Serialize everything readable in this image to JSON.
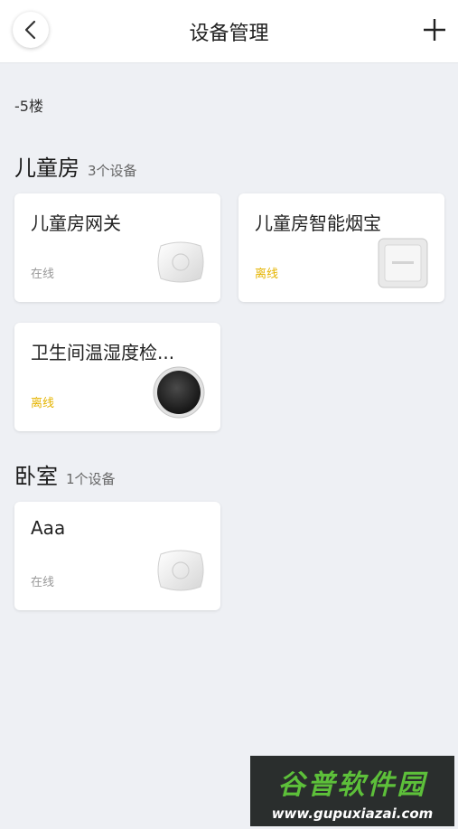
{
  "header": {
    "title": "设备管理",
    "back_icon": "chevron-left-icon",
    "add_icon": "plus-icon"
  },
  "floor_label": "-5楼",
  "rooms": [
    {
      "name": "儿童房",
      "count": "3个设备",
      "devices": [
        {
          "name": "儿童房网关",
          "status": "在线",
          "online": true,
          "icon": "gateway-device-icon"
        },
        {
          "name": "儿童房智能烟宝",
          "status": "离线",
          "online": false,
          "icon": "smoke-detector-icon"
        },
        {
          "name": "卫生间温湿度检...",
          "status": "离线",
          "online": false,
          "icon": "temp-humidity-sensor-icon"
        }
      ]
    },
    {
      "name": "卧室",
      "count": "1个设备",
      "devices": [
        {
          "name": "Aaa",
          "status": "在线",
          "online": true,
          "icon": "gateway-device-icon"
        }
      ]
    }
  ],
  "colors": {
    "background": "#eef0f4",
    "online": "#999999",
    "offline": "#e5b400"
  },
  "watermark": {
    "logo": "谷普软件园",
    "url": "www.gupuxiazai.com"
  }
}
